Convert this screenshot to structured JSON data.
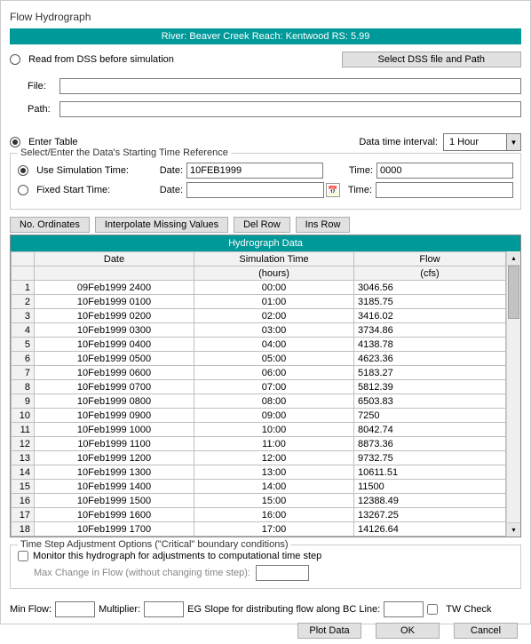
{
  "title": "Flow Hydrograph",
  "banner": "River: Beaver Creek  Reach: Kentwood  RS: 5.99",
  "readDss": {
    "label": "Read from DSS before simulation"
  },
  "selectDssBtn": "Select DSS file and Path",
  "fileLabel": "File:",
  "fileValue": "",
  "pathLabel": "Path:",
  "pathValue": "",
  "enterTable": {
    "label": "Enter Table"
  },
  "dataTimeIntervalLabel": "Data time interval:",
  "dataTimeIntervalValue": "1 Hour",
  "startTimeGroup": "Select/Enter the Data's Starting Time Reference",
  "useSim": {
    "label": "Use Simulation Time:"
  },
  "fixedStart": {
    "label": "Fixed Start Time:"
  },
  "dateLabel": "Date:",
  "timeLabel": "Time:",
  "simDate": "10FEB1999",
  "simTime": "0000",
  "fixedDate": "",
  "fixedTime": "",
  "btnNoOrdinates": "No. Ordinates",
  "btnInterpolate": "Interpolate Missing Values",
  "btnDelRow": "Del Row",
  "btnInsRow": "Ins Row",
  "gridTitle": "Hydrograph Data",
  "colDate": "Date",
  "colSim": "Simulation Time",
  "colFlow": "Flow",
  "unitHours": "(hours)",
  "unitCfs": "(cfs)",
  "rows": [
    {
      "n": "1",
      "date": "09Feb1999 2400",
      "sim": "00:00",
      "flow": "3046.56"
    },
    {
      "n": "2",
      "date": "10Feb1999 0100",
      "sim": "01:00",
      "flow": "3185.75"
    },
    {
      "n": "3",
      "date": "10Feb1999 0200",
      "sim": "02:00",
      "flow": "3416.02"
    },
    {
      "n": "4",
      "date": "10Feb1999 0300",
      "sim": "03:00",
      "flow": "3734.86"
    },
    {
      "n": "5",
      "date": "10Feb1999 0400",
      "sim": "04:00",
      "flow": "4138.78"
    },
    {
      "n": "6",
      "date": "10Feb1999 0500",
      "sim": "05:00",
      "flow": "4623.36"
    },
    {
      "n": "7",
      "date": "10Feb1999 0600",
      "sim": "06:00",
      "flow": "5183.27"
    },
    {
      "n": "8",
      "date": "10Feb1999 0700",
      "sim": "07:00",
      "flow": "5812.39"
    },
    {
      "n": "9",
      "date": "10Feb1999 0800",
      "sim": "08:00",
      "flow": "6503.83"
    },
    {
      "n": "10",
      "date": "10Feb1999 0900",
      "sim": "09:00",
      "flow": "7250"
    },
    {
      "n": "11",
      "date": "10Feb1999 1000",
      "sim": "10:00",
      "flow": "8042.74"
    },
    {
      "n": "12",
      "date": "10Feb1999 1100",
      "sim": "11:00",
      "flow": "8873.36"
    },
    {
      "n": "13",
      "date": "10Feb1999 1200",
      "sim": "12:00",
      "flow": "9732.75"
    },
    {
      "n": "14",
      "date": "10Feb1999 1300",
      "sim": "13:00",
      "flow": "10611.51"
    },
    {
      "n": "15",
      "date": "10Feb1999 1400",
      "sim": "14:00",
      "flow": "11500"
    },
    {
      "n": "16",
      "date": "10Feb1999 1500",
      "sim": "15:00",
      "flow": "12388.49"
    },
    {
      "n": "17",
      "date": "10Feb1999 1600",
      "sim": "16:00",
      "flow": "13267.25"
    },
    {
      "n": "18",
      "date": "10Feb1999 1700",
      "sim": "17:00",
      "flow": "14126.64"
    }
  ],
  "adjustGroup": "Time Step Adjustment Options (\"Critical\" boundary conditions)",
  "monitorLabel": "Monitor this hydrograph for adjustments to computational time step",
  "maxChangeLabel": "Max Change in Flow (without changing time step):",
  "minFlowLabel": "Min Flow:",
  "multiplierLabel": "Multiplier:",
  "egSlopeLabel": "EG Slope for distributing flow along BC Line:",
  "twCheckLabel": "TW Check",
  "btnPlot": "Plot Data",
  "btnOK": "OK",
  "btnCancel": "Cancel"
}
